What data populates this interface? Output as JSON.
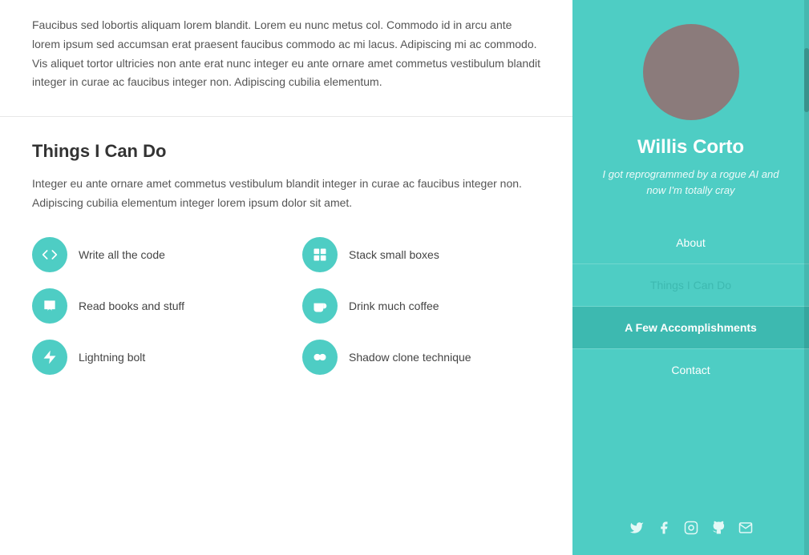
{
  "main": {
    "top_section": {
      "paragraph": "Faucibus sed lobortis aliquam lorem blandit. Lorem eu nunc metus col. Commodo id in arcu ante lorem ipsum sed accumsan erat praesent faucibus commodo ac mi lacus. Adipiscing mi ac commodo. Vis aliquet tortor ultricies non ante erat nunc integer eu ante ornare amet commetus vestibulum blandit integer in curae ac faucibus integer non. Adipiscing cubilia elementum."
    },
    "skills_section": {
      "title": "Things I Can Do",
      "intro": "Integer eu ante ornare amet commetus vestibulum blandit integer in curae ac faucibus integer non. Adipiscing cubilia elementum integer lorem ipsum dolor sit amet.",
      "skills": [
        {
          "label": "Write all the code",
          "icon": "code"
        },
        {
          "label": "Stack small boxes",
          "icon": "boxes"
        },
        {
          "label": "Read books and stuff",
          "icon": "book"
        },
        {
          "label": "Drink much coffee",
          "icon": "coffee"
        },
        {
          "label": "Lightning bolt",
          "icon": "bolt"
        },
        {
          "label": "Shadow clone technique",
          "icon": "clone"
        }
      ]
    }
  },
  "sidebar": {
    "profile": {
      "name": "Willis Corto",
      "tagline": "I got reprogrammed by a rogue AI and now I'm totally cray"
    },
    "nav": [
      {
        "label": "About",
        "active": false,
        "secondary": false
      },
      {
        "label": "Things I Can Do",
        "active": false,
        "secondary": true
      },
      {
        "label": "A Few Accomplishments",
        "active": true,
        "secondary": false
      },
      {
        "label": "Contact",
        "active": false,
        "secondary": false
      }
    ],
    "social": [
      {
        "icon": "twitter",
        "symbol": "𝕏"
      },
      {
        "icon": "facebook",
        "symbol": "f"
      },
      {
        "icon": "instagram",
        "symbol": "📷"
      },
      {
        "icon": "github",
        "symbol": "⌥"
      },
      {
        "icon": "email",
        "symbol": "✉"
      }
    ]
  }
}
